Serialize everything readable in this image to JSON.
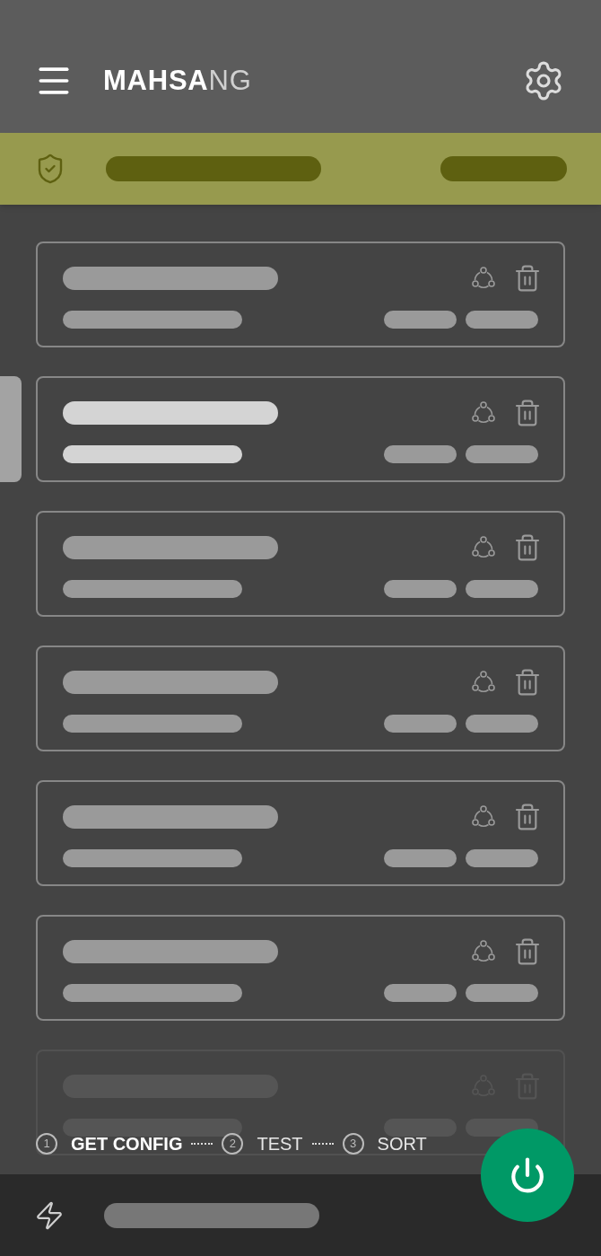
{
  "header": {
    "brand_bold": "MAHSA",
    "brand_light": "NG"
  },
  "cards": [
    {
      "selected": false,
      "faded": false
    },
    {
      "selected": true,
      "faded": false
    },
    {
      "selected": false,
      "faded": false
    },
    {
      "selected": false,
      "faded": false
    },
    {
      "selected": false,
      "faded": false
    },
    {
      "selected": false,
      "faded": false
    },
    {
      "selected": false,
      "faded": true
    }
  ],
  "steps": [
    {
      "number": "1",
      "label": "GET CONFIG",
      "active": true
    },
    {
      "number": "2",
      "label": "TEST",
      "active": false
    },
    {
      "number": "3",
      "label": "SORT",
      "active": false
    }
  ]
}
